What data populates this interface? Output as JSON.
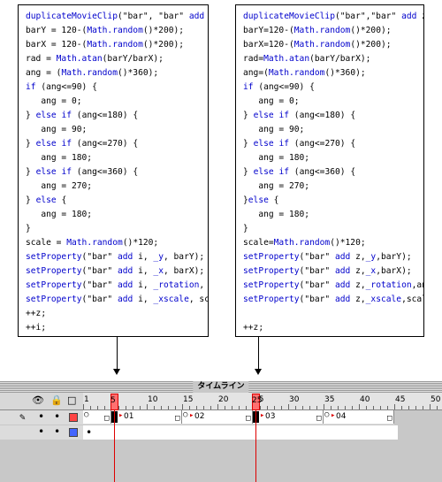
{
  "left_code": [
    "duplicateMovieClip(\"bar\", \"bar\" add i, z);",
    "barY = 120-(Math.random()*200);",
    "barX = 120-(Math.random()*200);",
    "rad = Math.atan(barY/barX);",
    "ang = (Math.random()*360);",
    "if (ang<=90) {",
    "   ang = 0;",
    "} else if (ang<=180) {",
    "   ang = 90;",
    "} else if (ang<=270) {",
    "   ang = 180;",
    "} else if (ang<=360) {",
    "   ang = 270;",
    "} else {",
    "   ang = 180;",
    "}",
    "scale = Math.random()*120;",
    "setProperty(\"bar\" add i, _y, barY);",
    "setProperty(\"bar\" add i, _x, barX);",
    "setProperty(\"bar\" add i, _rotation, ang);",
    "setProperty(\"bar\" add i, _xscale, scale);",
    "++z;",
    "++i;"
  ],
  "right_code": [
    "duplicateMovieClip(\"bar\",\"bar\" add z,z);",
    "barY=120-(Math.random()*200);",
    "barX=120-(Math.random()*200);",
    "rad=Math.atan(barY/barX);",
    "ang=(Math.random()*360);",
    "if (ang<=90) {",
    "   ang = 0;",
    "} else if (ang<=180) {",
    "   ang = 90;",
    "} else if (ang<=270) {",
    "   ang = 180;",
    "} else if (ang<=360) {",
    "   ang = 270;",
    "}else {",
    "   ang = 180;",
    "}",
    "scale=Math.random()*120;",
    "setProperty(\"bar\" add z,_y,barY);",
    "setProperty(\"bar\" add z,_x,barX);",
    "setProperty(\"bar\" add z,_rotation,ang);",
    "setProperty(\"bar\" add z,_xscale,scale);",
    "",
    "++z;"
  ],
  "timeline": {
    "title": "タイムライン",
    "header_icons": {
      "eye": "eye-icon",
      "lock": "lock-icon",
      "outline": "outline-square-icon"
    },
    "ruler_numbers": [
      "1",
      "5",
      "10",
      "15",
      "20",
      "25",
      "30",
      "35",
      "40",
      "45",
      "50"
    ],
    "frame_labels": [
      "01",
      "02",
      "03",
      "04"
    ],
    "layer1": {
      "pencil": "✎",
      "dot1": "•",
      "dot2": "•",
      "color": "#ff4444"
    },
    "layer2": {
      "dot1": "•",
      "dot2": "•",
      "color": "#4466ff",
      "keyframe_dot": "•"
    },
    "playhead_frames": [
      "5",
      "25"
    ],
    "playhead_color": "#dd0000"
  }
}
